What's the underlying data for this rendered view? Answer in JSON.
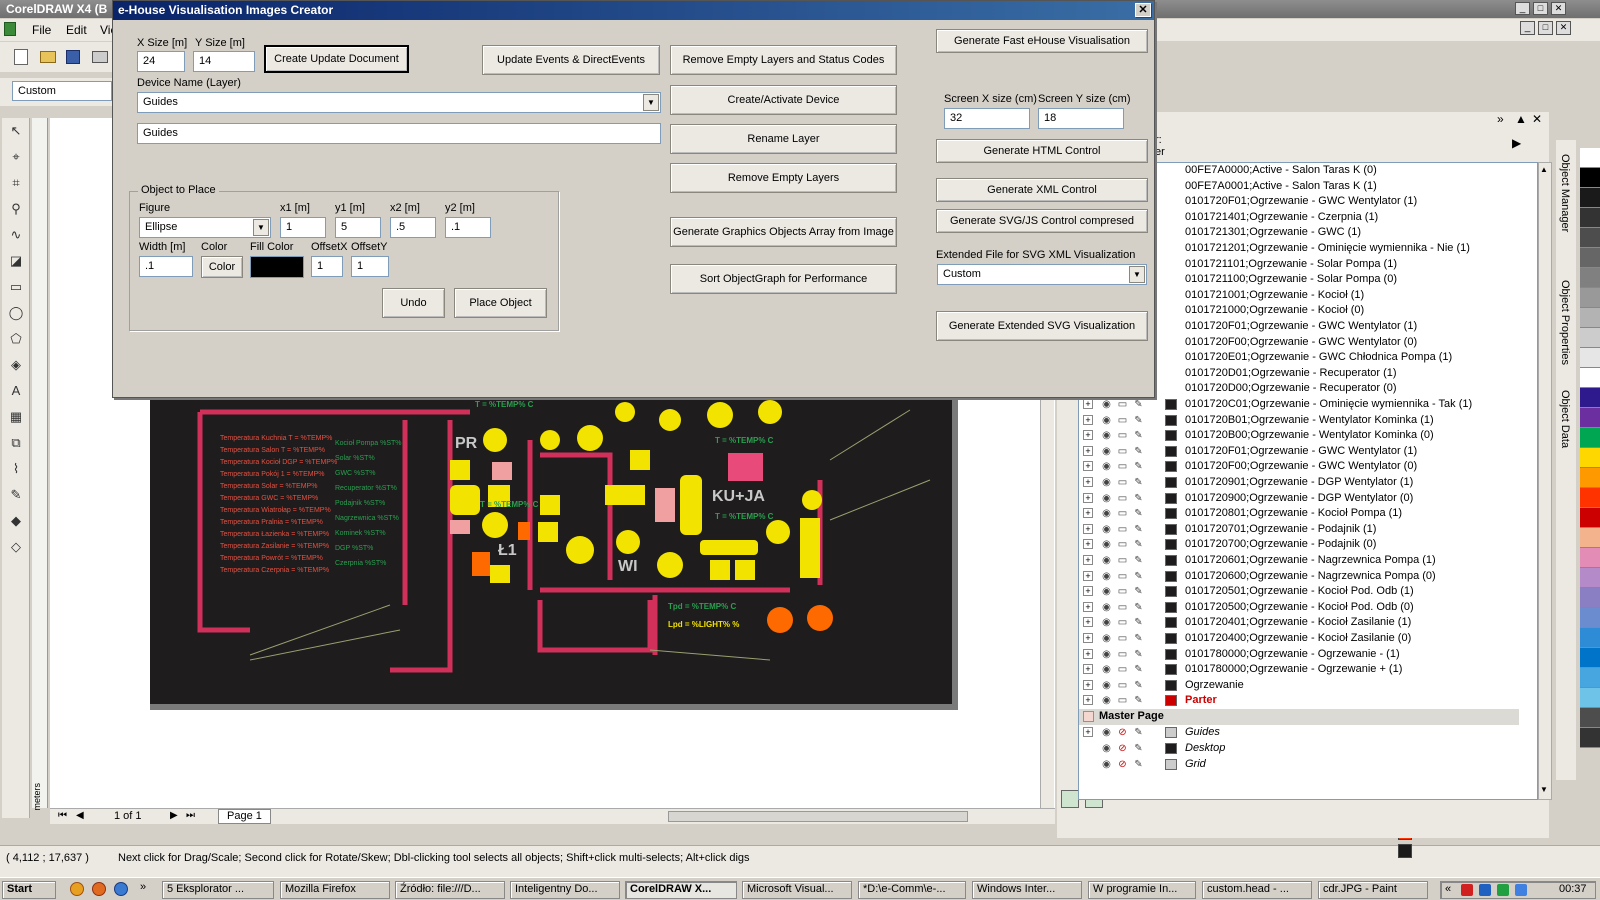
{
  "app": {
    "title": "CorelDRAW X4 (B",
    "menus": [
      "File",
      "Edit",
      "Vie"
    ],
    "property_bar_value": "Custom",
    "win_controls": [
      "_",
      "□",
      "✕"
    ]
  },
  "dialog": {
    "title": "e-House Visualisation Images Creator",
    "close_label": "✕",
    "xsize_label": "X Size [m]",
    "xsize_value": "24",
    "ysize_label": "Y Size [m]",
    "ysize_value": "14",
    "create_update_label": "Create Update Document",
    "update_events_label": "Update Events & DirectEvents",
    "remove_empty_status_label": "Remove Empty Layers and Status Codes",
    "generate_fast_label": "Generate Fast eHouse Visualisation",
    "device_name_label": "Device Name (Layer)",
    "device_name_select": "Guides",
    "device_name_value": "Guides",
    "create_activate_label": "Create/Activate Device",
    "rename_layer_label": "Rename Layer",
    "remove_empty_layers_label": "Remove Empty Layers",
    "screen_x_label": "Screen X size (cm)",
    "screen_x_value": "32",
    "screen_y_label": "Screen Y size (cm)",
    "screen_y_value": "18",
    "generate_html_label": "Generate HTML Control",
    "generate_xml_label": "Generate XML Control",
    "generate_svg_label": "Generate SVG/JS Control compresed",
    "generate_graphics_label": "Generate Graphics Objects Array from Image",
    "sort_label": "Sort ObjectGraph for Performance",
    "extended_file_label": "Extended File for SVG XML Visualization",
    "extended_file_value": "Custom",
    "generate_extended_label": "Generate Extended SVG Visualization",
    "object_group": {
      "title": "Object to Place",
      "figure_label": "Figure",
      "figure_value": "Ellipse",
      "x1_label": "x1 [m]",
      "x1_value": "1",
      "y1_label": "y1 [m]",
      "y1_value": "5",
      "x2_label": "x2 [m]",
      "x2_value": ".5",
      "y2_label": "y2 [m]",
      "y2_value": ".1",
      "width_label": "Width [m]",
      "width_value": ".1",
      "color_label": "Color",
      "color_button": "Color",
      "fill_color_label": "Fill Color",
      "fill_color": "#000000",
      "offsetx_label": "OffsetX",
      "offsetx_value": "1",
      "offsety_label": "OffsetY",
      "offsety_value": "1",
      "undo_label": "Undo",
      "place_label": "Place Object"
    }
  },
  "canvas": {
    "page_count": "1 of 1",
    "page_tab": "Page 1",
    "units": "meters",
    "plan_labels": {
      "pr": "PR",
      "kuja": "KU+JA",
      "wi": "WI",
      "l1": "Ł1",
      "temp1": "T = %TEMP% C",
      "temp2": "T = %TEMP% C",
      "temp3": "T = %TEMP% C",
      "temp4": "T = %TEMP% C",
      "tpd": "Tpd = %TEMP% C",
      "lpd": "Lpd = %LIGHT% %"
    }
  },
  "status": {
    "coords": "( 4,112 ; 17,637 )",
    "hint": "Next click for Drag/Scale; Second click for Rotate/Skew; Dbl-clicking tool selects all objects; Shift+click multi-selects; Alt+click digs"
  },
  "object_manager": {
    "tab_labels": [
      "Object Manager",
      "Object Properties",
      "Object Data"
    ],
    "header_partial": "r:",
    "header_partial2": "er",
    "items": [
      "00FE7A0000;Active - Salon Taras K (0)",
      "00FE7A0001;Active - Salon Taras K (1)",
      "0101720F01;Ogrzewanie - GWC Wentylator (1)",
      "0101721401;Ogrzewanie - Czerpnia (1)",
      "0101721301;Ogrzewanie - GWC (1)",
      "0101721201;Ogrzewanie - Ominięcie wymiennika - Nie (1)",
      "0101721101;Ogrzewanie - Solar Pompa (1)",
      "0101721100;Ogrzewanie - Solar Pompa (0)",
      "0101721001;Ogrzewanie - Kocioł (1)",
      "0101721000;Ogrzewanie - Kocioł (0)",
      "0101720F01;Ogrzewanie - GWC Wentylator (1)",
      "0101720F00;Ogrzewanie - GWC Wentylator (0)",
      "0101720E01;Ogrzewanie - GWC Chłodnica Pompa (1)",
      "0101720D01;Ogrzewanie - Recuperator (1)",
      "0101720D00;Ogrzewanie - Recuperator (0)",
      "0101720C01;Ogrzewanie - Ominięcie wymiennika - Tak (1)",
      "0101720B01;Ogrzewanie - Wentylator Kominka (1)",
      "0101720B00;Ogrzewanie - Wentylator Kominka (0)",
      "0101720F01;Ogrzewanie - GWC Wentylator (1)",
      "0101720F00;Ogrzewanie - GWC Wentylator (0)",
      "0101720901;Ogrzewanie - DGP Wentylator (1)",
      "0101720900;Ogrzewanie - DGP Wentylator (0)",
      "0101720801;Ogrzewanie - Kocioł Pompa (1)",
      "0101720701;Ogrzewanie - Podajnik (1)",
      "0101720700;Ogrzewanie - Podajnik (0)",
      "0101720601;Ogrzewanie - Nagrzewnica Pompa (1)",
      "0101720600;Ogrzewanie - Nagrzewnica Pompa (0)",
      "0101720501;Ogrzewanie - Kocioł Pod. Odb (1)",
      "0101720500;Ogrzewanie - Kocioł Pod. Odb (0)",
      "0101720401;Ogrzewanie - Kocioł Zasilanie (1)",
      "0101720400;Ogrzewanie - Kocioł Zasilanie (0)",
      "0101780000;Ogrzewanie - Ogrzewanie - (1)",
      "0101780000;Ogrzewanie - Ogrzewanie + (1)",
      "Ogrzewanie"
    ],
    "parter": "Parter",
    "master_page": "Master Page",
    "master_items": [
      "Guides",
      "Desktop",
      "Grid"
    ]
  },
  "palette": [
    "#ffffff",
    "#000000",
    "#1a1a1a",
    "#333333",
    "#4d4d4d",
    "#666666",
    "#808080",
    "#999999",
    "#b3b3b3",
    "#cccccc",
    "#e6e6e6",
    "#ffffff",
    "#2e1a8c",
    "#6b2fa0",
    "#00a651",
    "#ffd700",
    "#ff9900",
    "#ff3300",
    "#cc0000",
    "#f3b38d",
    "#e38cb5",
    "#b48ac9",
    "#8a7fc2",
    "#6b8ccf",
    "#2e8bd6",
    "#0074c8",
    "#47a6e0",
    "#6ec4e8",
    "#4d4d4d",
    "#333333"
  ],
  "taskbar": {
    "start": "Start",
    "tasks": [
      "5 Eksplorator ...",
      "Mozilla Firefox",
      "Źródło: file:///D...",
      "Inteligentny Do...",
      "CorelDRAW X...",
      "Microsoft Visual...",
      "*D:\\e-Comm\\e-...",
      "Windows Inter...",
      "W programie In...",
      "custom.head - ...",
      "cdr.JPG - Paint"
    ],
    "clock": "00:37"
  }
}
